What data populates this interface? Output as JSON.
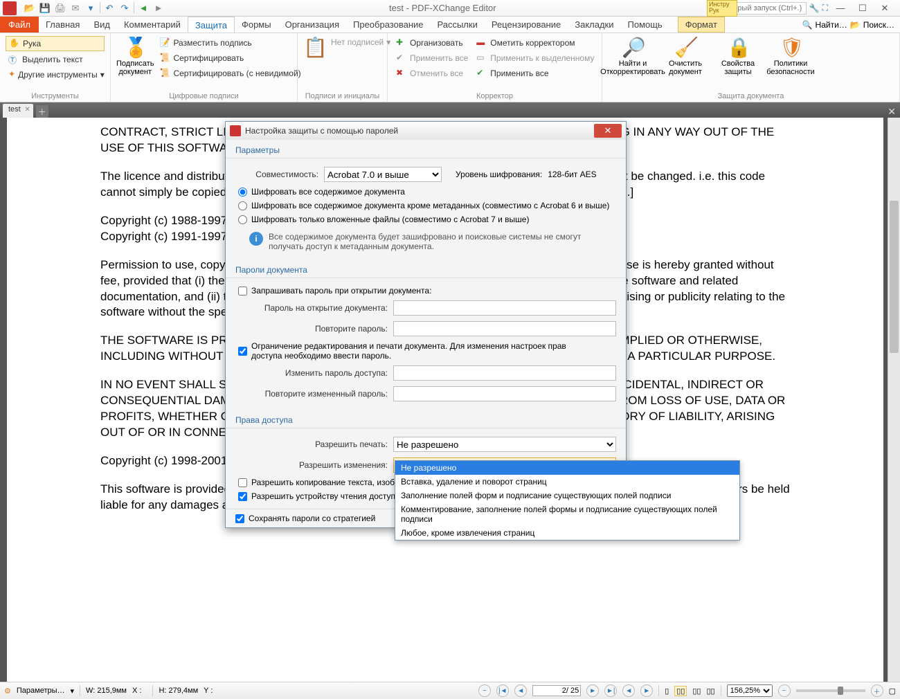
{
  "app_title": "test - PDF-XChange Editor",
  "quick_launch_placeholder": "Быстрый запуск (Ctrl+.)",
  "tooltip_box": "Инстру\nРук",
  "menubar": {
    "file": "Файл",
    "tabs": [
      "Главная",
      "Вид",
      "Комментарий",
      "Защита",
      "Формы",
      "Организация",
      "Преобразование",
      "Рассылки",
      "Рецензирование",
      "Закладки",
      "Помощь"
    ],
    "format": "Формат",
    "find": "Найти…",
    "search": "Поиск…"
  },
  "ribbon": {
    "tools": {
      "hand": "Рука",
      "select_text": "Выделить текст",
      "other_tools": "Другие инструменты",
      "group": "Инструменты"
    },
    "sign": {
      "sign_doc": "Подписать документ",
      "place_sig": "Разместить подпись",
      "certify": "Сертифицировать",
      "certify_inv": "Сертифицировать (с невидимой)",
      "group": "Цифровые подписи"
    },
    "sigs": {
      "none": "Нет подписей",
      "group": "Подписи и инициалы"
    },
    "redact": {
      "organize": "Организовать",
      "apply_all": "Применить все",
      "cancel_all": "Отменить все",
      "mark": "Ометить корректором",
      "apply_sel": "Применить к выделенному",
      "apply_all2": "Применить все",
      "group": "Корректор"
    },
    "protect": {
      "find_redact": "Найти и Откорректировать",
      "sanitize": "Очистить документ",
      "sec_props": "Свойства защиты",
      "sec_pol": "Политики безопасности",
      "group": "Защита документа"
    }
  },
  "doc_tab": "test",
  "document_text": {
    "p1": "CONTRACT, STRICT LIABILITY, OR TORT (INCLUDING NEGLIGENCE OR OTHERWISE) ARISING IN ANY WAY OUT OF THE USE OF THIS SOFTWARE, EVEN IF ADVISED OF THE POSSIBILITY OF SUCH DAMAGE.",
    "p2": "The licence and distribution terms for any publically available version or derivative of this code cannot be changed.  i.e. this code cannot simply be copied and put under another distribution licence [including the GNU Public Licence.]",
    "p3a": "Copyright (c) 1988-1997 Sam Leffler",
    "p3b": "Copyright (c) 1991-1997 Silicon Graphics, Inc.",
    "p4": "Permission to use, copy, modify, distribute, and sell this software and its documentation for any purpose is hereby granted without fee, provided that (i) the above copyright notices and this permission notice appear in all copies of the software and related documentation, and (ii) the names of Sam Leffler and Silicon Graphics may not be used in any advertising or publicity relating to the software without the specific, prior written permission of Sam Leffler and Silicon Graphics.",
    "p5": "THE SOFTWARE IS PROVIDED \"AS-IS\" AND WITHOUT WARRANTY OF ANY KIND, EXPRESS, IMPLIED OR OTHERWISE, INCLUDING WITHOUT LIMITATION, ANY WARRANTY OF MERCHANTABILITY OR FITNESS FOR A PARTICULAR PURPOSE.",
    "p6": "IN NO EVENT SHALL SAM LEFFLER OR SILICON GRAPHICS BE LIABLE FOR ANY SPECIAL, INCIDENTAL, INDIRECT OR CONSEQUENTIAL DAMAGES OF ANY KIND, OR ANY DAMAGES WHATSOEVER RESULTING FROM LOSS OF USE, DATA OR PROFITS, WHETHER OR NOT ADVISED OF THE POSSIBILITY OF DAMAGE, AND ON ANY THEORY OF LIABILITY, ARISING OUT OF OR IN CONNECTION WITH THE USE OR PERFORMANCE OF THIS SOFTWARE.",
    "p7": "Copyright (c) 1998-2001 Greg Roelofs.  All rights reserved.",
    "p8": "This software is provided \"as is,\" without warranty of any kind, express or implied.  In no event shall the author or contributors be held liable for any damages arising in any way from the use of this software."
  },
  "dialog": {
    "title": "Настройка защиты с помощью паролей",
    "section_params": "Параметры",
    "compat_label": "Совместимость:",
    "compat_value": "Acrobat 7.0 и выше",
    "enc_level_label": "Уровень шифрования:",
    "enc_level_value": "128-бит AES",
    "r1": "Шифровать все содержимое документа",
    "r2": "Шифровать все содержимое документа кроме метаданных (совместимо с Acrobat 6 и выше)",
    "r3": "Шифровать только вложенные файлы (совместимо с Acrobat 7 и выше)",
    "info": "Все содержимое документа будет зашифровано и поисковые системы не смогут получать доступ к метаданным документа.",
    "section_pw": "Пароли документа",
    "c_open": "Запрашивать пароль при открытии документа:",
    "open_pw": "Пароль на открытие документа:",
    "open_pw2": "Повторите пароль:",
    "c_perm": "Ограничение редактирования и печати документа.  Для изменения настроек прав доступа необходимо ввести пароль.",
    "perm_pw": "Изменить пароль доступа:",
    "perm_pw2": "Повторите измененный пароль:",
    "section_perm": "Права доступа",
    "allow_print": "Разрешить печать:",
    "allow_print_val": "Не разрешено",
    "allow_changes": "Разрешить изменения:",
    "allow_changes_val": "Не разрешено",
    "c_copy": "Разрешить копирование текста, изображений и другого контента",
    "c_reader": "Разрешить устройству чтения доступ к тексту для пользователей с нарушением зрения",
    "save_strategy": "Сохранять пароли со стратегией",
    "dropdown": [
      "Не разрешено",
      "Вставка, удаление и поворот страниц",
      "Заполнение полей форм и подписание существующих полей подписи",
      "Комментирование, заполнение полей формы и подписание существующих полей подписи",
      "Любое, кроме извлечения страниц"
    ]
  },
  "status": {
    "params": "Параметры…",
    "w": "W: 215,9мм",
    "h": "H: 279,4мм",
    "x": "X :",
    "y": "Y :",
    "page": "2/ 25",
    "zoom": "156,25%"
  }
}
